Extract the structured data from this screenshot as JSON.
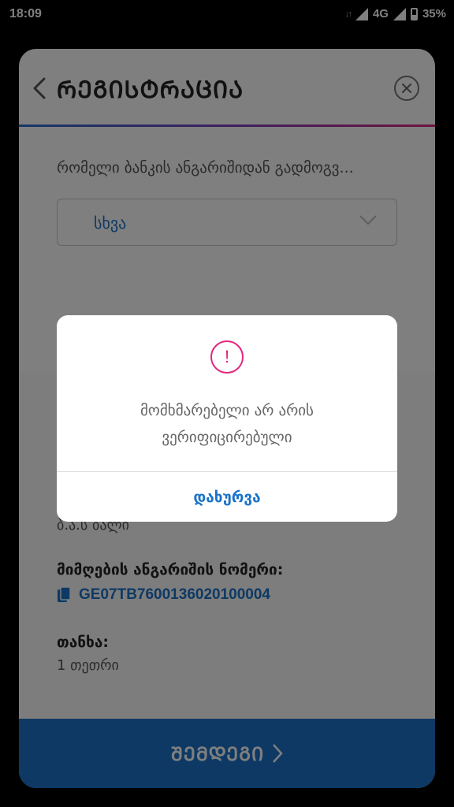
{
  "status_bar": {
    "time": "18:09",
    "network": "4G",
    "battery": "35%",
    "battery_level": 0.35
  },
  "header": {
    "title": "ᲠᲔᲒᲘᲡᲢᲠᲐᲪᲘᲐ",
    "back_icon": "chevron-left-icon",
    "close_icon": "close-circle-icon"
  },
  "form": {
    "bank_question": "რომელი ბანკის ანგარიშიდან გადმოგვ...",
    "bank_select_value": "სხვა",
    "partial_value": "ბ.ა.ს ბალი",
    "account_label": "მიმღების ანგარიშის ნომერი:",
    "account_number": "GE07TB7600136020100004",
    "amount_label": "თანხა:",
    "amount_value": "1 თეთრი"
  },
  "footer": {
    "next_label": "ᲨᲔᲛᲓᲔᲒᲘ"
  },
  "dialog": {
    "message_line1": "მომხმარებელი არ არის",
    "message_line2": "ვერიფიცირებული",
    "close_label": "დახურვა"
  },
  "colors": {
    "accent_blue": "#1a73c9",
    "alert_pink": "#e0267f",
    "gradient_start": "#2b6fd2",
    "gradient_end": "#e0267f"
  }
}
